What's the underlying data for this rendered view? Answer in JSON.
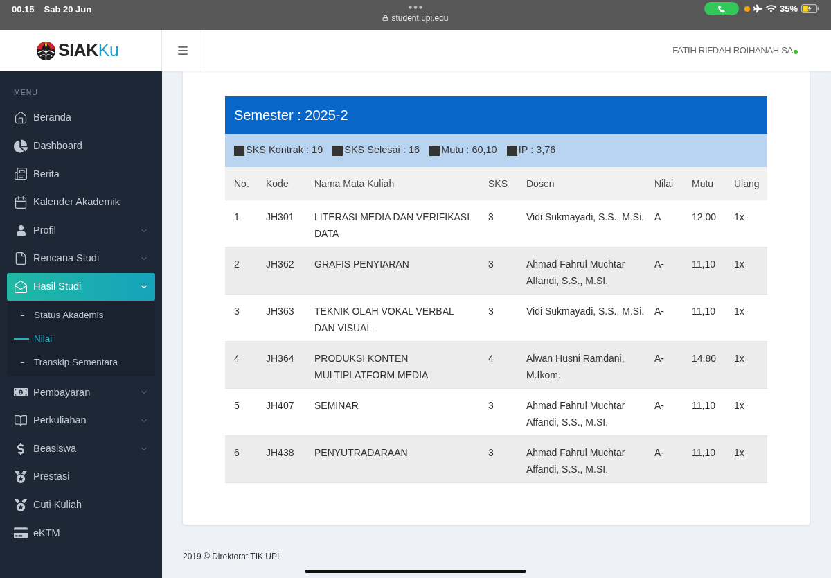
{
  "status_bar": {
    "time": "00.15",
    "date": "Sab 20 Jun",
    "url": "student.upi.edu",
    "battery": "35%"
  },
  "header": {
    "logo": [
      "SIAK",
      "Ku"
    ],
    "user_name": "FATIH RIFDAH ROIHANAH SA"
  },
  "sidebar": {
    "heading": "MENU",
    "items": [
      {
        "label": "Beranda",
        "kind": "link",
        "selected": false
      },
      {
        "label": "Dashboard",
        "kind": "link",
        "selected": false
      },
      {
        "label": "Berita",
        "kind": "link",
        "selected": false
      },
      {
        "label": "Kalender Akademik",
        "kind": "link",
        "selected": false
      },
      {
        "label": "Profil",
        "kind": "submenu",
        "selected": false
      },
      {
        "label": "Rencana Studi",
        "kind": "submenu",
        "selected": false
      },
      {
        "label": "Hasil Studi",
        "kind": "submenu",
        "selected": true,
        "children": [
          {
            "label": "Status Akademis",
            "selected": false
          },
          {
            "label": "Nilai",
            "selected": true
          },
          {
            "label": "Transkip Sementara",
            "selected": false
          }
        ]
      },
      {
        "label": "Pembayaran",
        "kind": "submenu",
        "selected": false
      },
      {
        "label": "Perkuliahan",
        "kind": "submenu",
        "selected": false
      },
      {
        "label": "Beasiswa",
        "kind": "submenu",
        "selected": false
      },
      {
        "label": "Prestasi",
        "kind": "link",
        "selected": false
      },
      {
        "label": "Cuti Kuliah",
        "kind": "link",
        "selected": false
      },
      {
        "label": "eKTM",
        "kind": "link",
        "selected": false
      }
    ]
  },
  "semester": {
    "title": "Semester : 2025-2",
    "summary": [
      "SKS Kontrak : 19",
      "SKS Selesai : 16",
      "Mutu : 60,10",
      "IP : 3,76"
    ],
    "table": {
      "columns": [
        "No.",
        "Kode",
        "Nama Mata Kuliah",
        "SKS",
        "Dosen",
        "Nilai",
        "Mutu",
        "Ulang"
      ],
      "rows": [
        [
          "1",
          "JH301",
          "LITERASI MEDIA DAN VERIFIKASI DATA",
          "3",
          "Vidi Sukmayadi, S.S., M.Si.",
          "A",
          "12,00",
          "1x"
        ],
        [
          "2",
          "JH362",
          "GRAFIS PENYIARAN",
          "3",
          "Ahmad Fahrul Muchtar Affandi, S.S., M.SI.",
          "A-",
          "11,10",
          "1x"
        ],
        [
          "3",
          "JH363",
          "TEKNIK OLAH VOKAL VERBAL DAN VISUAL",
          "3",
          "Vidi Sukmayadi, S.S., M.Si.",
          "A-",
          "11,10",
          "1x"
        ],
        [
          "4",
          "JH364",
          "PRODUKSI KONTEN MULTIPLATFORM MEDIA",
          "4",
          "Alwan Husni Ramdani, M.Ikom.",
          "A-",
          "14,80",
          "1x"
        ],
        [
          "5",
          "JH407",
          "SEMINAR",
          "3",
          "Ahmad Fahrul Muchtar Affandi, S.S., M.SI.",
          "A-",
          "11,10",
          "1x"
        ],
        [
          "6",
          "JH438",
          "PENYUTRADARAAN",
          "3",
          "Ahmad Fahrul Muchtar Affandi, S.S., M.SI.",
          "A-",
          "11,10",
          "1x"
        ]
      ]
    }
  },
  "footer": "2019 © Direktorat TIK UPI"
}
